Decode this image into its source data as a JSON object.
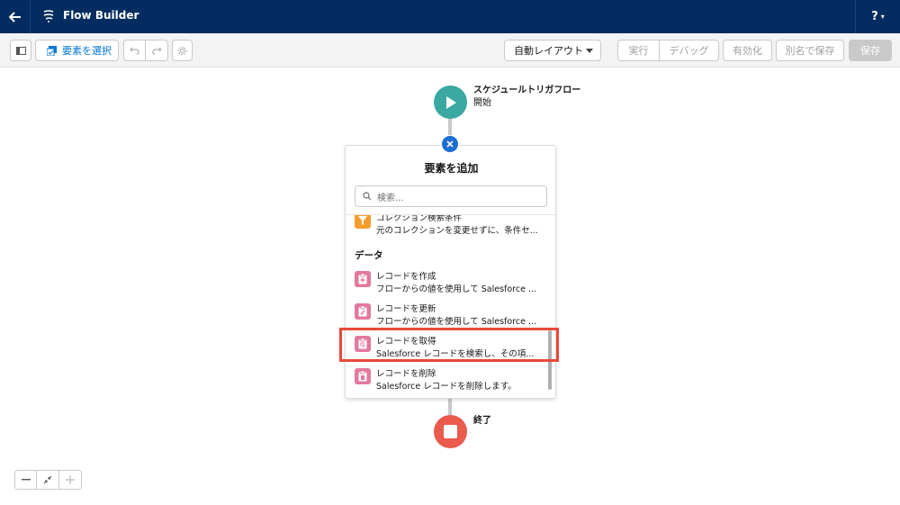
{
  "header": {
    "app_title": "Flow Builder",
    "help_label": "?"
  },
  "toolbar": {
    "select_elements_label": "要素を選択",
    "layout_select_value": "自動レイアウト",
    "run_label": "実行",
    "debug_label": "デバッグ",
    "activate_label": "有効化",
    "save_as_label": "別名で保存",
    "save_label": "保存"
  },
  "canvas": {
    "start": {
      "title": "スケジュールトリガフロー",
      "subtitle": "開始"
    },
    "end": {
      "label": "終了"
    }
  },
  "panel": {
    "title": "要素を追加",
    "search_placeholder": "検索...",
    "partial_item": {
      "title": "コレクション検索条件",
      "description": "元のコレクションを変更せずに、条件セ..."
    },
    "section_data": "データ",
    "items": [
      {
        "title": "レコードを作成",
        "description": "フローからの値を使用して Salesforce ..."
      },
      {
        "title": "レコードを更新",
        "description": "フローからの値を使用して Salesforce ..."
      },
      {
        "title": "レコードを取得",
        "description": "Salesforce レコードを検索し、その項..."
      },
      {
        "title": "レコードを削除",
        "description": "Salesforce レコードを削除します。"
      }
    ]
  },
  "colors": {
    "header_bg": "#032d60",
    "start_node": "#3ba8a2",
    "end_node": "#ea5a4d",
    "record_icon": "#e3799c",
    "filter_icon": "#f59d2c",
    "highlight": "#e8493a",
    "accent": "#0176d3"
  }
}
